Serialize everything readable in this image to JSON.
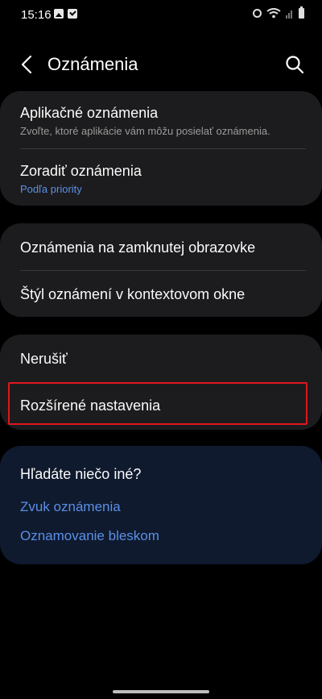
{
  "status_bar": {
    "time": "15:16",
    "icons": [
      "image-icon",
      "check-icon",
      "alarm-icon",
      "wifi-icon",
      "signal-icon",
      "battery-icon"
    ]
  },
  "header": {
    "title": "Oznámenia",
    "back_icon": "back-arrow-icon",
    "search_icon": "search-icon"
  },
  "groups": [
    {
      "items": [
        {
          "title": "Aplikačné oznámenia",
          "subtitle": "Zvoľte, ktoré aplikácie vám môžu posielať oznámenia."
        },
        {
          "title": "Zoradiť oznámenia",
          "subtitle": "Podľa priority"
        }
      ]
    },
    {
      "items": [
        {
          "title": "Oznámenia na zamknutej obrazovke"
        },
        {
          "title": "Štýl oznámení v kontextovom okne"
        }
      ]
    },
    {
      "items": [
        {
          "title": "Nerušiť"
        },
        {
          "title": "Rozšírené nastavenia"
        }
      ]
    }
  ],
  "help": {
    "title": "Hľadáte niečo iné?",
    "links": [
      "Zvuk oznámenia",
      "Oznamovanie bleskom"
    ]
  },
  "colors": {
    "background": "#000000",
    "card": "#1c1c1e",
    "help_card": "#0f1a2e",
    "accent": "#5b8fe6",
    "highlight": "#e0161e"
  }
}
